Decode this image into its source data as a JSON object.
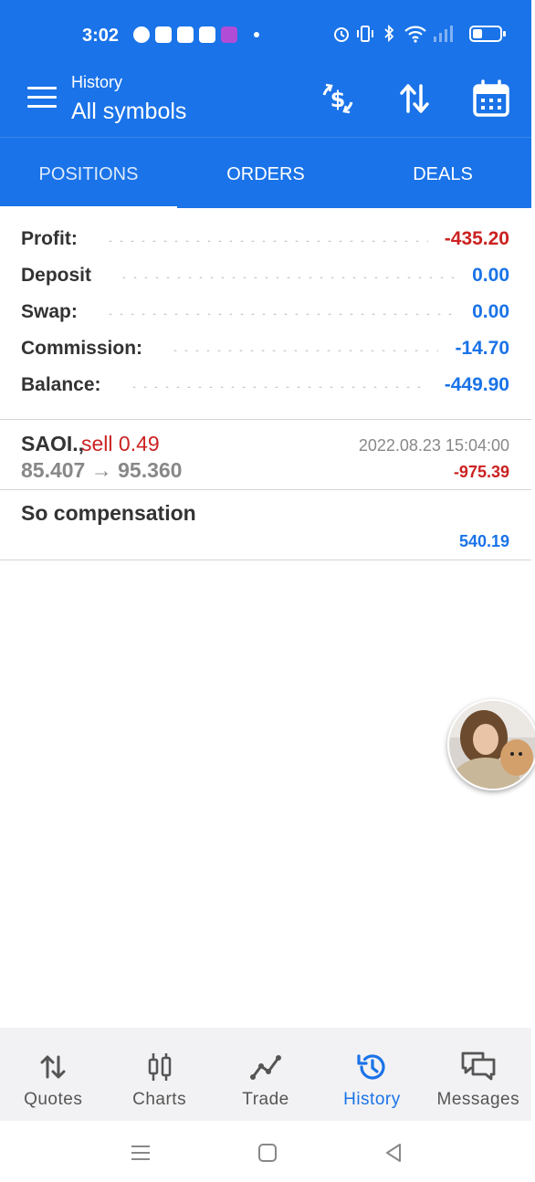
{
  "status_bar": {
    "time": "3:02"
  },
  "toolbar": {
    "subtitle": "History",
    "title": "All symbols",
    "icons": [
      "currency-exchange-icon",
      "sort-icon",
      "calendar-icon"
    ]
  },
  "tabs": [
    {
      "label": "POSITIONS",
      "active": true
    },
    {
      "label": "ORDERS",
      "active": false
    },
    {
      "label": "DEALS",
      "active": false
    }
  ],
  "summary": {
    "profit": {
      "label": "Profit:",
      "value": "-435.20"
    },
    "deposit": {
      "label": "Deposit",
      "value": "0.00"
    },
    "swap": {
      "label": "Swap:",
      "value": "0.00"
    },
    "commission": {
      "label": "Commission:",
      "value": "-14.70"
    },
    "balance": {
      "label": "Balance:",
      "value": "-449.90"
    }
  },
  "deal": {
    "symbol": "SAOI.,",
    "side": "sell 0.49",
    "time": "2022.08.23 15:04:00",
    "prices": "85.407 → 95.360",
    "profit": "-975.39"
  },
  "compensation": {
    "title": "So compensation",
    "value": "540.19"
  },
  "bottom_nav": [
    {
      "label": "Quotes",
      "icon": "quotes-icon",
      "active": false
    },
    {
      "label": "Charts",
      "icon": "charts-icon",
      "active": false
    },
    {
      "label": "Trade",
      "icon": "trade-icon",
      "active": false
    },
    {
      "label": "History",
      "icon": "history-icon",
      "active": true
    },
    {
      "label": "Messages",
      "icon": "messages-icon",
      "active": false
    }
  ],
  "colors": {
    "primary": "#1a73e8",
    "negative": "#cc2222",
    "positive": "#1a73e8"
  }
}
